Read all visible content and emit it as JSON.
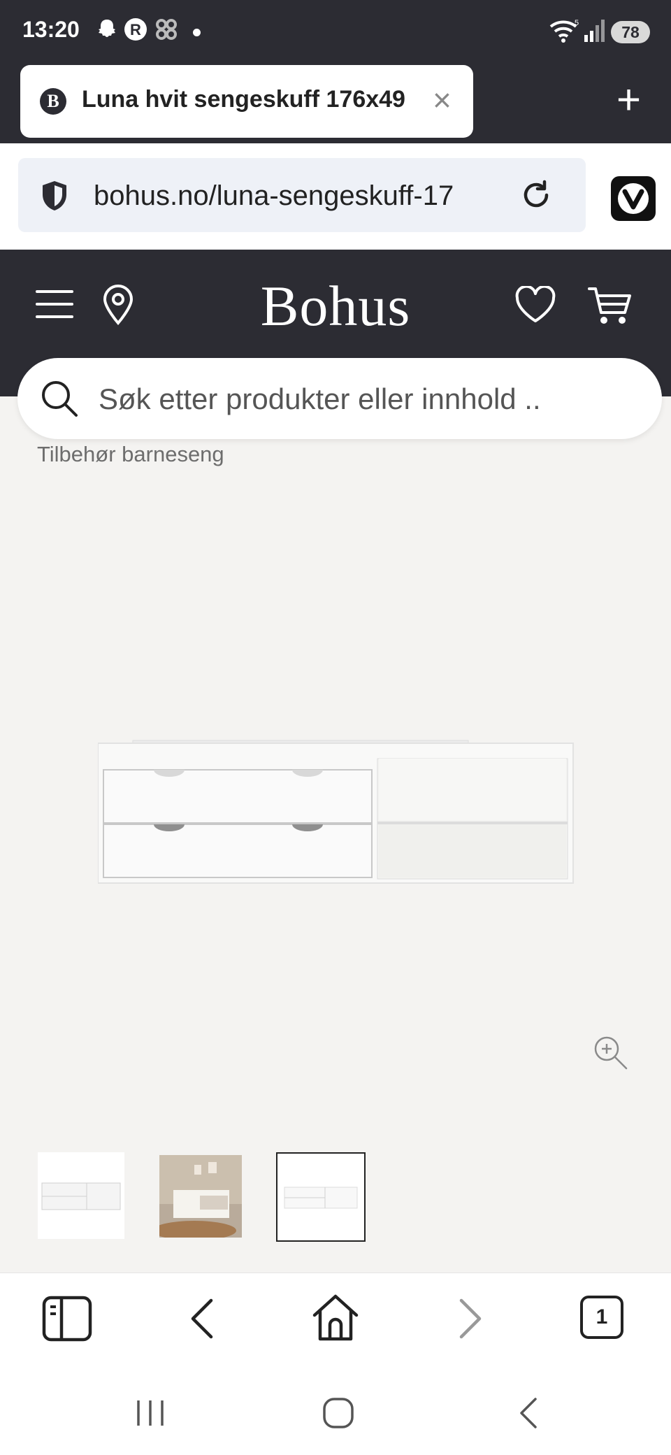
{
  "status_bar": {
    "time": "13:20",
    "battery": "78",
    "network": "5"
  },
  "browser": {
    "tab_title": "Luna hvit sengeskuff 176x49",
    "favicon_letter": "B",
    "url": "bohus.no/luna-sengeskuff-17",
    "tab_count": "1"
  },
  "site": {
    "logo": "Bohus",
    "search_placeholder": "Søk etter produkter eller innhold ..",
    "breadcrumb": "Tilbehør barneseng"
  },
  "colors": {
    "header": "#2c2c33",
    "page_bg": "#f4f3f1"
  },
  "icons": [
    "menu-icon",
    "location-pin-icon",
    "heart-icon",
    "cart-icon",
    "search-icon",
    "zoom-in-icon"
  ]
}
